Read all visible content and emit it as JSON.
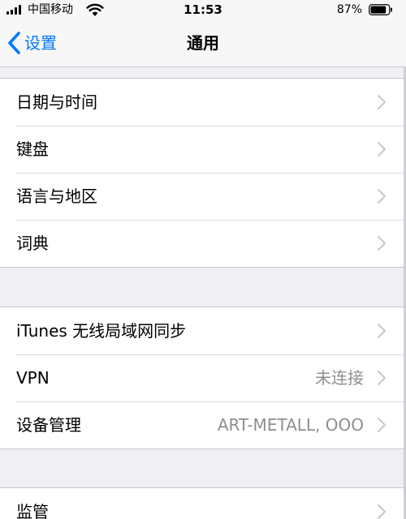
{
  "status_bar": {
    "carrier": "中国移动",
    "time": "11:53",
    "battery": "87%",
    "battery_level": 0.87
  },
  "nav": {
    "back_label": "设置",
    "title": "通用"
  },
  "groups": [
    {
      "rows": [
        {
          "label": "日期与时间",
          "value": ""
        },
        {
          "label": "键盘",
          "value": ""
        },
        {
          "label": "语言与地区",
          "value": ""
        },
        {
          "label": "词典",
          "value": ""
        }
      ]
    },
    {
      "rows": [
        {
          "label": "iTunes 无线局域网同步",
          "value": ""
        },
        {
          "label": "VPN",
          "value": "未连接"
        },
        {
          "label": "设备管理",
          "value": "ART-METALL, OOO"
        }
      ]
    },
    {
      "rows": [
        {
          "label": "监管",
          "value": ""
        }
      ]
    }
  ],
  "colors": {
    "accent": "#007aff",
    "background": "#efeff4",
    "secondary_text": "#8e8e93",
    "chevron": "#c7c7cc"
  }
}
